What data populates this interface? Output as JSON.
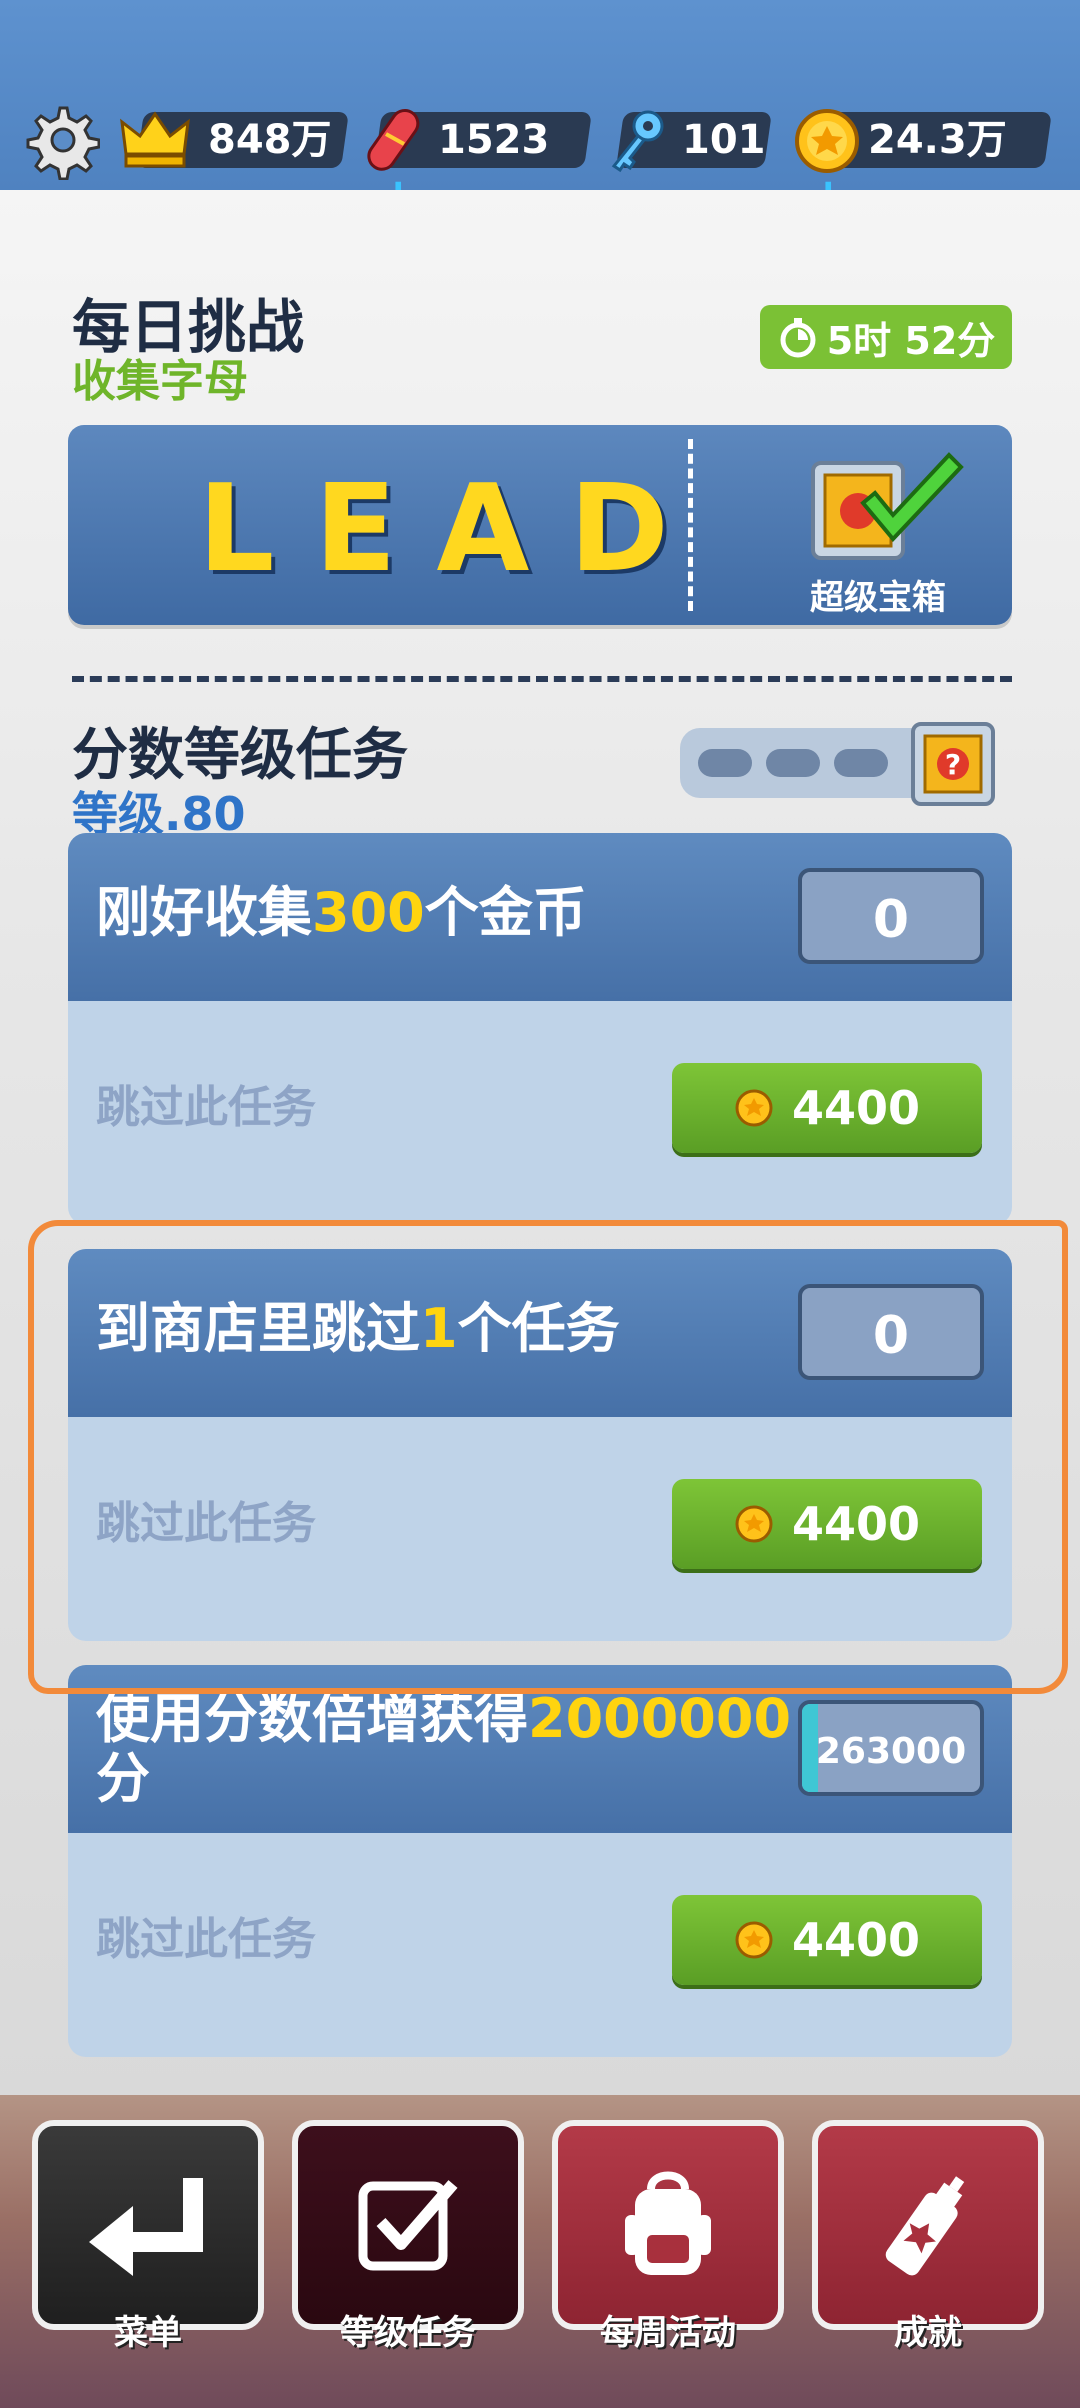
{
  "topbar": {
    "crown_value": "848万",
    "board_value": "1523",
    "key_value": "101",
    "coin_value": "24.3万",
    "plus": "+"
  },
  "daily": {
    "title": "每日挑战",
    "subtitle": "收集字母",
    "timer": "5时 52分",
    "word": "LEAD",
    "chest_label": "超级宝箱"
  },
  "ranked": {
    "title": "分数等级任务",
    "level": "等级.80"
  },
  "missions": [
    {
      "title_pre": "刚好收集",
      "title_hl": "300",
      "title_post": "个金币",
      "count": "0",
      "skip": "跳过此任务",
      "price": "4400"
    },
    {
      "title_pre": "到商店里跳过",
      "title_hl": "1",
      "title_post": "个任务",
      "count": "0",
      "skip": "跳过此任务",
      "price": "4400"
    },
    {
      "title_pre": "使用分数倍增获得",
      "title_hl": "2000000",
      "title_post": "分",
      "count": "263000",
      "skip": "跳过此任务",
      "price": "4400"
    }
  ],
  "nav": [
    {
      "label": "菜单",
      "icon": "return-arrow-icon"
    },
    {
      "label": "等级任务",
      "icon": "checkbox-icon"
    },
    {
      "label": "每周活动",
      "icon": "backpack-icon"
    },
    {
      "label": "成就",
      "icon": "spray-can-icon"
    }
  ],
  "colors": {
    "accent_green": "#7bc135",
    "highlight_yellow": "#ffd40f",
    "panel_blue": "#4670a7",
    "annotation_orange": "#f28a3a"
  }
}
